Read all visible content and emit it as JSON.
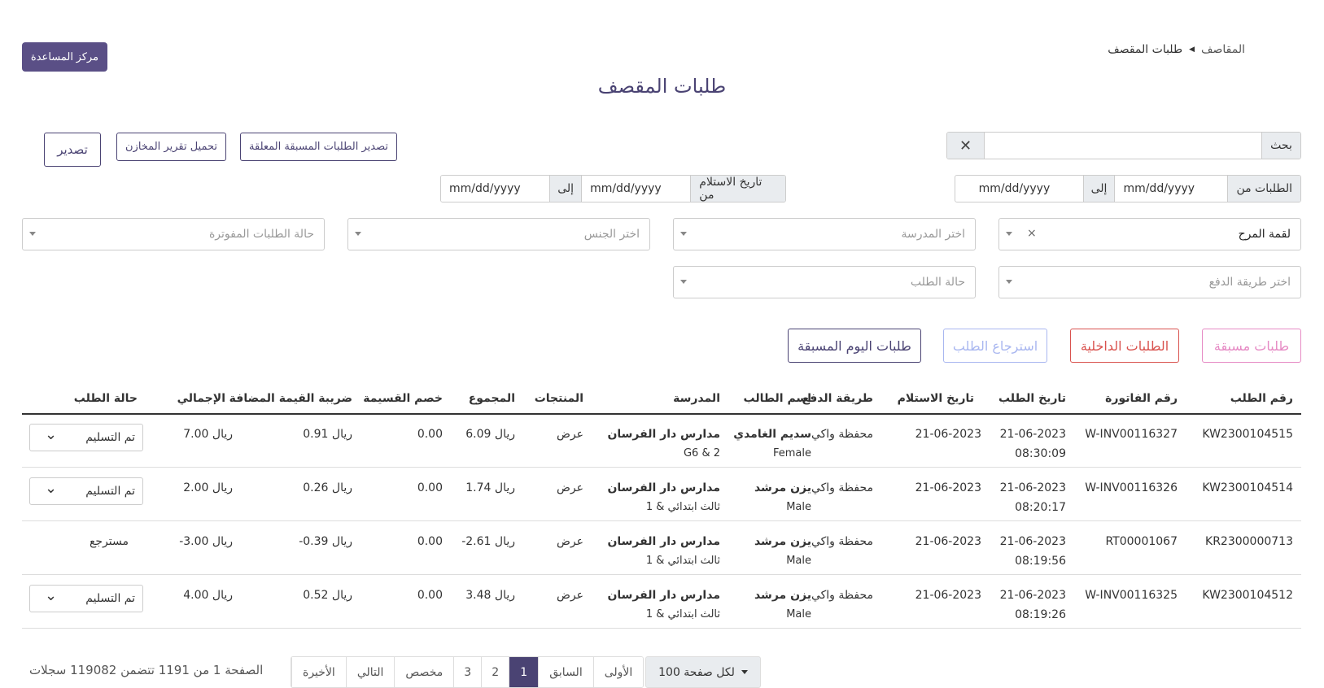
{
  "breadcrumb": {
    "home": "المقاصف",
    "current": "طلبات المقصف"
  },
  "help_button": "مركز المساعدة",
  "page_title": "طلبات المقصف",
  "toolbar": {
    "export_pending": "تصدير الطلبات المسبقة المعلقة",
    "warehouse_report": "تحميل تقرير المخازن",
    "export": "تصدير"
  },
  "search": {
    "label": "بحث",
    "value": ""
  },
  "filters": {
    "orders_from_label": "الطلبات من",
    "to_label": "إلى",
    "date_placeholder": "mm/dd/yyyy",
    "received_from_label": "تاريخ الاستلام من",
    "canteen": "لقمة المرح",
    "school_placeholder": "اختر المدرسة",
    "gender_placeholder": "اختر الجنس",
    "invoiced_status_placeholder": "حالة الطلبات المفوترة",
    "payment_placeholder": "اختر طريقة الدفع",
    "order_status_placeholder": "حالة الطلب"
  },
  "tabs": {
    "preorders": "طلبات مسبقة",
    "internal": "الطلبات الداخلية",
    "refund": "استرجاع الطلب",
    "today_preorders": "طلبات اليوم المسبقة"
  },
  "colors": {
    "primary": "#4a4373",
    "pink": "#e68ac4",
    "red": "#d9534f",
    "lightblue": "#a9b7f0"
  },
  "table": {
    "headers": {
      "order_no": "رقم الطلب",
      "invoice_no": "رقم الفاتورة",
      "order_date": "تاريخ الطلب",
      "receive_date": "تاريخ الاستلام",
      "payment": "طريقة الدفع",
      "student": "اسم الطالب",
      "school": "المدرسة",
      "products": "المنتجات",
      "total_sum": "المجموع",
      "coupon": "خصم القسيمة",
      "vat": "ضريبة القيمة المضافة",
      "grand_total": "الإجمالي",
      "status": "حالة الطلب"
    },
    "rows": [
      {
        "order_no": "KW2300104515",
        "invoice_no": "W-INV00116327",
        "order_date": "21-06-2023",
        "order_time": "08:30:09",
        "receive_date": "21-06-2023",
        "payment": "محفظة واكي",
        "student": "سديم الغامدي",
        "gender": "Female",
        "school": "مدارس دار الفرسان",
        "grade": "G6 & 2",
        "products": "عرض",
        "total_sum": "6.09 ريال",
        "coupon": "0.00",
        "vat": "0.91 ريال",
        "grand_total": "7.00 ريال",
        "status": "تم التسليم"
      },
      {
        "order_no": "KW2300104514",
        "invoice_no": "W-INV00116326",
        "order_date": "21-06-2023",
        "order_time": "08:20:17",
        "receive_date": "21-06-2023",
        "payment": "محفظة واكي",
        "student": "يزن مرشد",
        "gender": "Male",
        "school": "مدارس دار الفرسان",
        "grade": "ثالث ابتدائي & 1",
        "products": "عرض",
        "total_sum": "1.74 ريال",
        "coupon": "0.00",
        "vat": "0.26 ريال",
        "grand_total": "2.00 ريال",
        "status": "تم التسليم"
      },
      {
        "order_no": "KR2300000713",
        "invoice_no": "RT00001067",
        "order_date": "21-06-2023",
        "order_time": "08:19:56",
        "receive_date": "21-06-2023",
        "payment": "محفظة واكي",
        "student": "يزن مرشد",
        "gender": "Male",
        "school": "مدارس دار الفرسان",
        "grade": "ثالث ابتدائي & 1",
        "products": "عرض",
        "total_sum": "-2.61 ريال",
        "coupon": "0.00",
        "vat": "-0.39 ريال",
        "grand_total": "-3.00 ريال",
        "status": "مسترجع"
      },
      {
        "order_no": "KW2300104512",
        "invoice_no": "W-INV00116325",
        "order_date": "21-06-2023",
        "order_time": "08:19:26",
        "receive_date": "21-06-2023",
        "payment": "محفظة واكي",
        "student": "يزن مرشد",
        "gender": "Male",
        "school": "مدارس دار الفرسان",
        "grade": "ثالث ابتدائي & 1",
        "products": "عرض",
        "total_sum": "3.48 ريال",
        "coupon": "0.00",
        "vat": "0.52 ريال",
        "grand_total": "4.00 ريال",
        "status": "تم التسليم"
      }
    ]
  },
  "pagination": {
    "per_page": "100 لكل صفحة",
    "first": "الأولى",
    "prev": "السابق",
    "pages": [
      "1",
      "2",
      "3"
    ],
    "custom": "مخصص",
    "next": "التالي",
    "last": "الأخيرة",
    "info": "الصفحة 1 من 1191 تتضمن 119082 سجلات"
  }
}
